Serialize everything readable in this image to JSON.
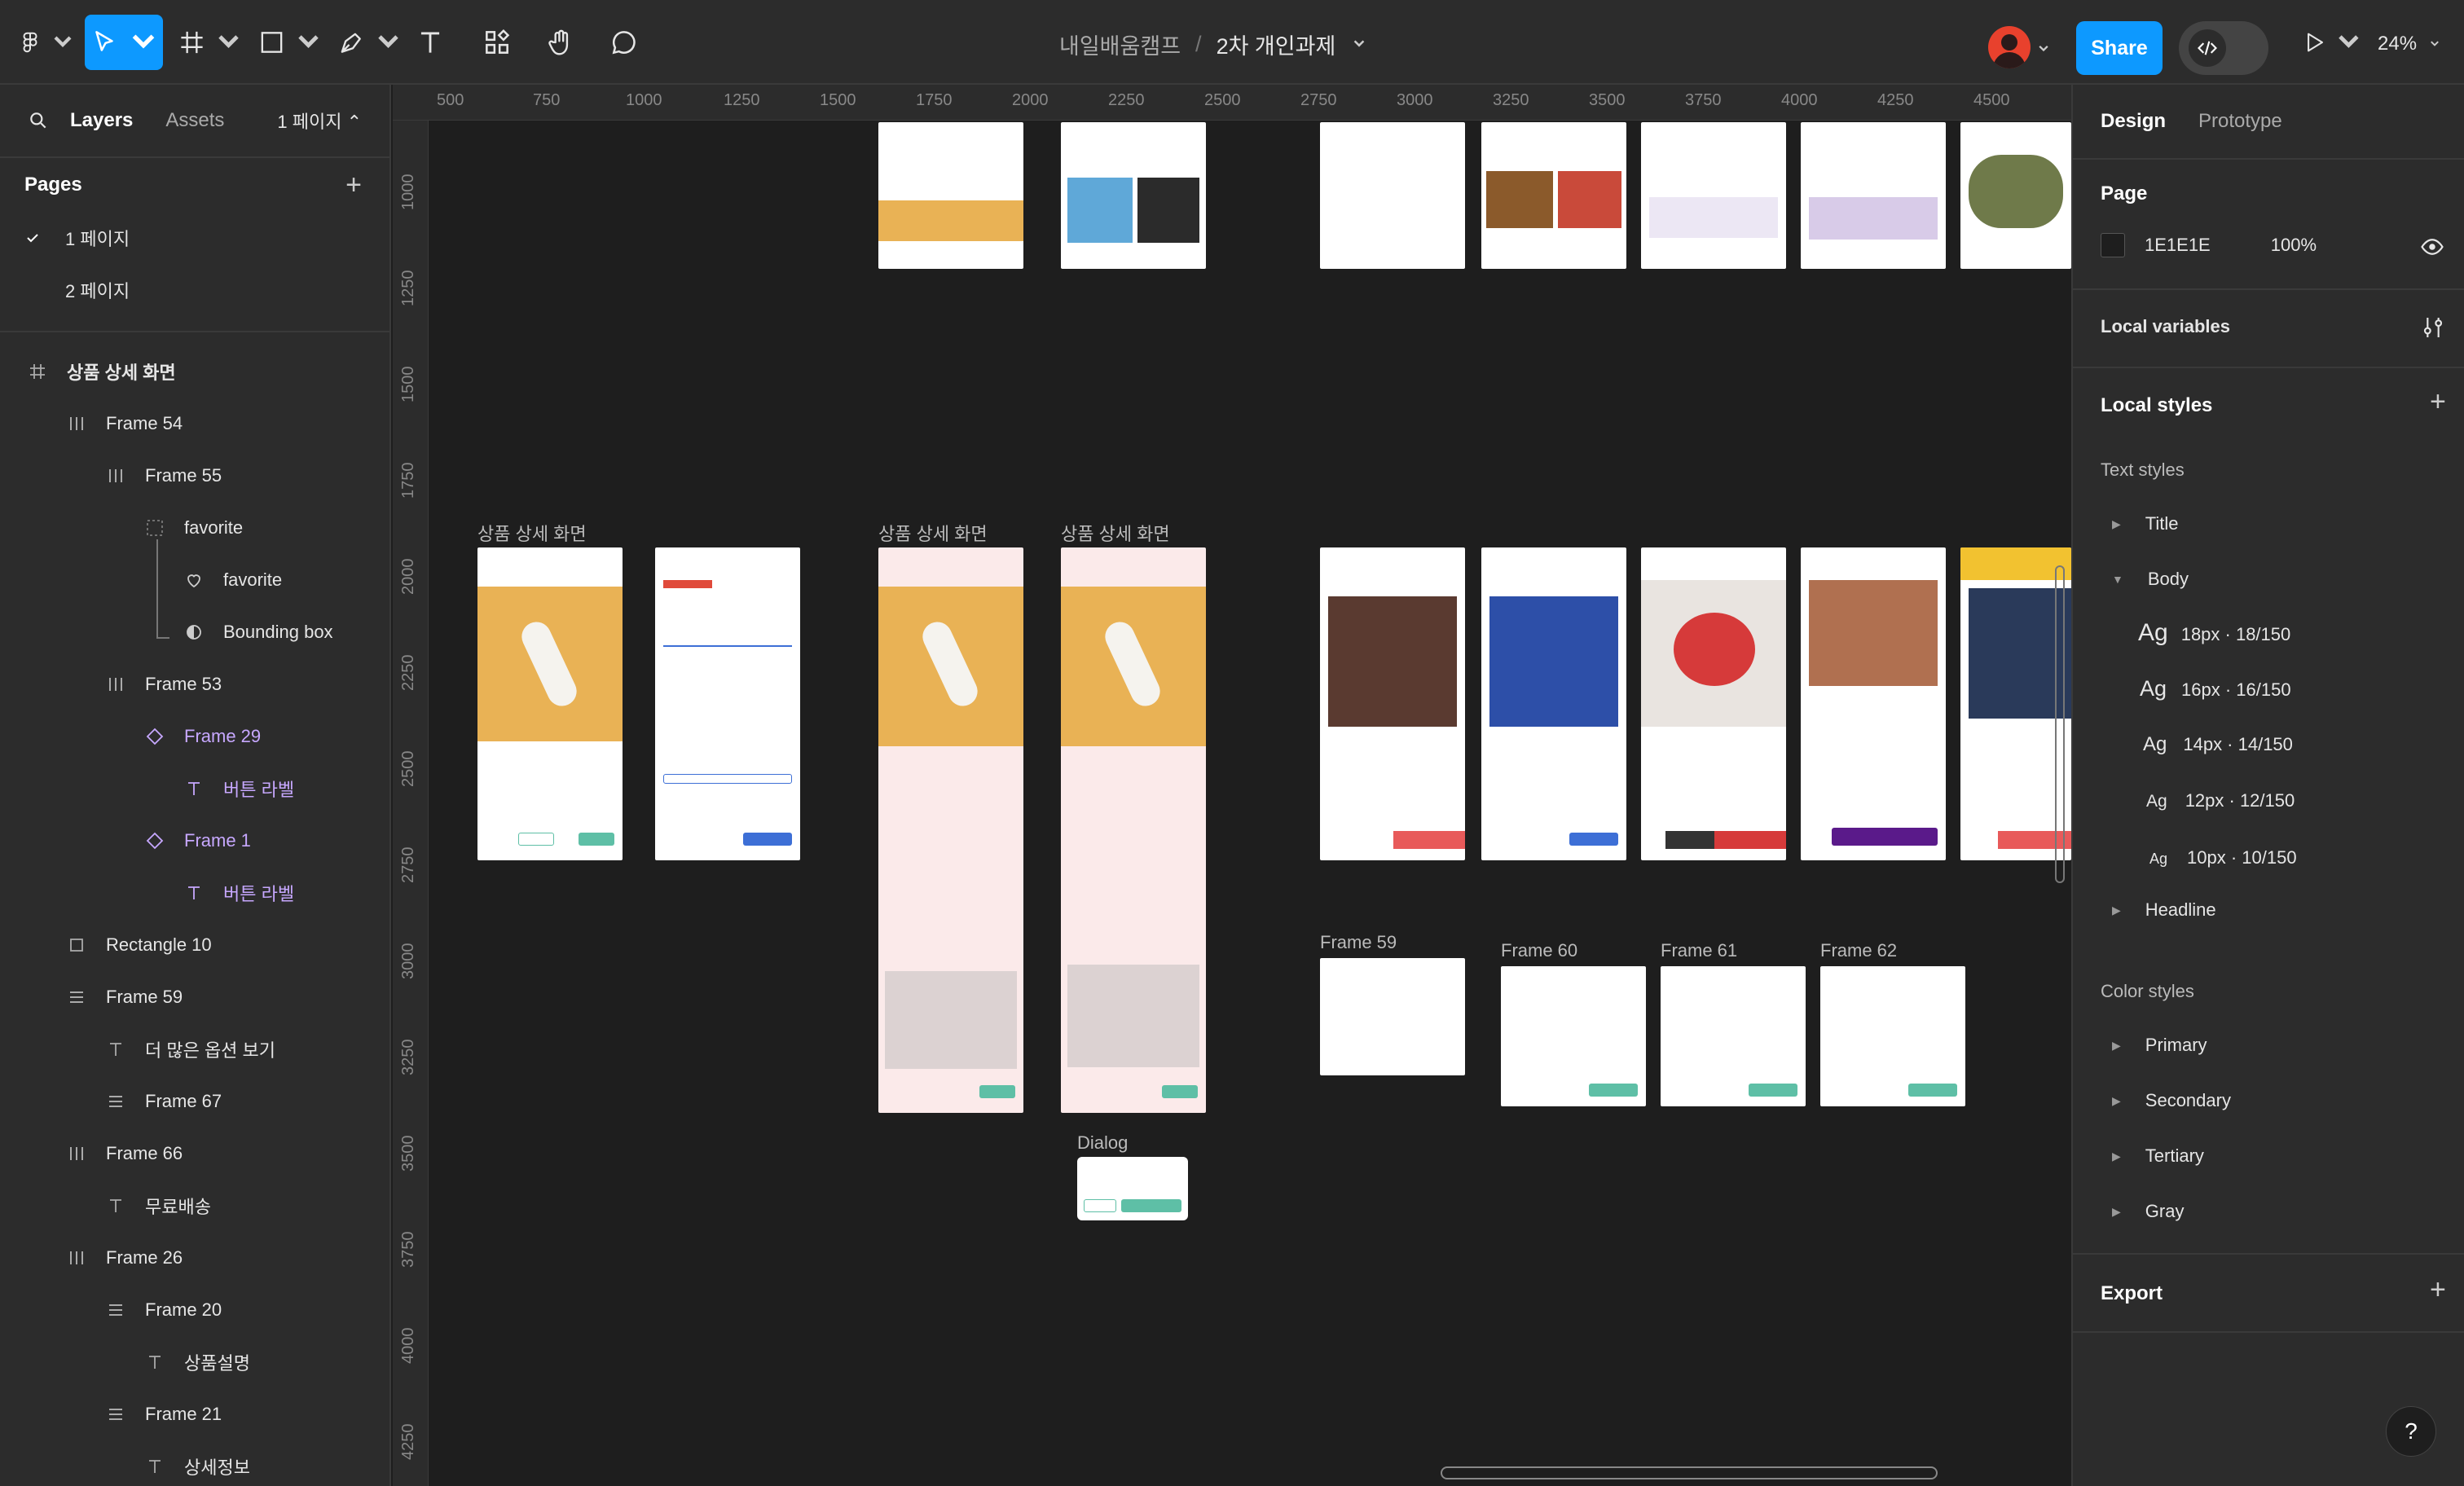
{
  "toolbar": {
    "breadcrumb_team": "내일배움캠프",
    "separator": "/",
    "file_name": "2차 개인과제",
    "share_label": "Share",
    "zoom": "24%"
  },
  "left_panel": {
    "tab_layers": "Layers",
    "tab_assets": "Assets",
    "page_selector": "1 페이지",
    "pages_heading": "Pages",
    "pages": [
      "1 페이지",
      "2 페이지"
    ],
    "layers": [
      {
        "label": "상품 상세 화면",
        "icon": "frame-hash-icon"
      },
      {
        "label": "Frame 54",
        "icon": "auto-layout-vertical-icon"
      },
      {
        "label": "Frame 55",
        "icon": "auto-layout-vertical-icon"
      },
      {
        "label": "favorite",
        "icon": "dashed-frame-icon"
      },
      {
        "label": "favorite",
        "icon": "heart-icon"
      },
      {
        "label": "Bounding box",
        "icon": "mask-icon"
      },
      {
        "label": "Frame 53",
        "icon": "auto-layout-vertical-icon"
      },
      {
        "label": "Frame 29",
        "icon": "component-instance-icon"
      },
      {
        "label": "버튼 라벨",
        "icon": "text-icon"
      },
      {
        "label": "Frame 1",
        "icon": "component-instance-icon"
      },
      {
        "label": "버튼 라벨",
        "icon": "text-icon"
      },
      {
        "label": "Rectangle 10",
        "icon": "rectangle-icon"
      },
      {
        "label": "Frame 59",
        "icon": "auto-layout-horizontal-icon"
      },
      {
        "label": "더 많은 옵션 보기",
        "icon": "text-icon"
      },
      {
        "label": "Frame 67",
        "icon": "auto-layout-horizontal-icon"
      },
      {
        "label": "Frame 66",
        "icon": "auto-layout-vertical-icon"
      },
      {
        "label": "무료배송",
        "icon": "text-icon"
      },
      {
        "label": "Frame 26",
        "icon": "auto-layout-vertical-icon"
      },
      {
        "label": "Frame 20",
        "icon": "auto-layout-horizontal-icon"
      },
      {
        "label": "상품설명",
        "icon": "text-icon"
      },
      {
        "label": "Frame 21",
        "icon": "auto-layout-horizontal-icon"
      },
      {
        "label": "상세정보",
        "icon": "text-icon"
      }
    ]
  },
  "canvas": {
    "ruler_top": [
      "500",
      "750",
      "1000",
      "1250",
      "1500",
      "1750",
      "2000",
      "2250",
      "2500",
      "2750",
      "3000",
      "3250",
      "3500",
      "3750",
      "4000",
      "4250",
      "4500"
    ],
    "ruler_left": [
      "1000",
      "1250",
      "1500",
      "1750",
      "2000",
      "2250",
      "2500",
      "2750",
      "3000",
      "3250",
      "3500",
      "3750",
      "4000",
      "4250"
    ],
    "frame_labels": {
      "detail_1": "상품 상세 화면",
      "detail_2": "상품 상세 화면",
      "detail_3": "상품 상세 화면",
      "frame59": "Frame 59",
      "frame60": "Frame 60",
      "frame61": "Frame 61",
      "frame62": "Frame 62",
      "dialog": "Dialog"
    }
  },
  "right_panel": {
    "tab_design": "Design",
    "tab_prototype": "Prototype",
    "page_heading": "Page",
    "page_color": "1E1E1E",
    "page_opacity": "100%",
    "local_variables": "Local variables",
    "local_styles": "Local styles",
    "text_styles_heading": "Text styles",
    "text_styles": {
      "title": "Title",
      "body": "Body",
      "headline": "Headline",
      "body_items": [
        "18px · 18/150",
        "16px · 16/150",
        "14px · 14/150",
        "12px · 12/150",
        "10px · 10/150"
      ],
      "ag": "Ag"
    },
    "color_styles_heading": "Color styles",
    "color_styles": [
      "Primary",
      "Secondary",
      "Tertiary",
      "Gray"
    ],
    "export": "Export",
    "help": "?"
  },
  "colors": {
    "accent": "#0d99ff",
    "canvas": "#1e1e1e",
    "panel": "#2c2c2c",
    "component_purple": "#c7a8ff",
    "mint_button": "#5ebfa6",
    "product_bg": "#e9b255"
  }
}
